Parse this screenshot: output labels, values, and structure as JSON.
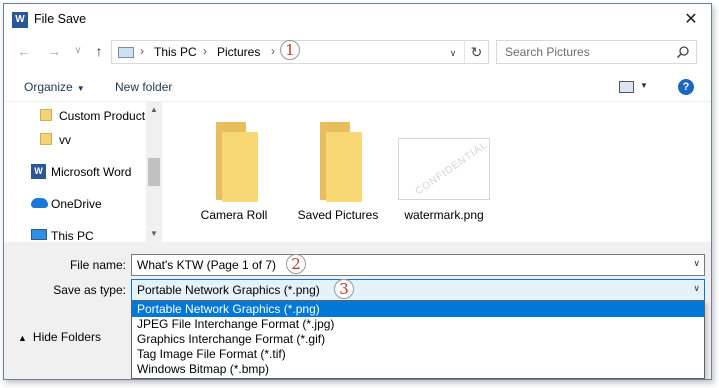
{
  "window": {
    "title": "File Save",
    "app_icon_glyph": "W",
    "close_glyph": "✕"
  },
  "nav": {
    "back_glyph": "←",
    "forward_glyph": "→",
    "history_glyph": "∨",
    "up_glyph": "↑",
    "breadcrumb": [
      "This PC",
      "Pictures"
    ],
    "separator": "›",
    "dropdown_glyph": "∨",
    "refresh_glyph": "↻",
    "search_placeholder": "Search Pictures"
  },
  "toolbar": {
    "organize_label": "Organize",
    "new_folder_label": "New folder",
    "caret": "▼",
    "help_glyph": "?"
  },
  "sidebar": {
    "items": [
      {
        "label": "Custom Product",
        "icon": "folder-icon"
      },
      {
        "label": "vv",
        "icon": "folder-icon"
      },
      {
        "label": "Microsoft Word",
        "icon": "word-icon"
      },
      {
        "label": "OneDrive",
        "icon": "onedrive-icon"
      },
      {
        "label": "This PC",
        "icon": "pc-icon"
      }
    ],
    "scroll_up_glyph": "▲",
    "scroll_down_glyph": "▼"
  },
  "files": [
    {
      "name": "Camera Roll",
      "icon": "folder-icon"
    },
    {
      "name": "Saved Pictures",
      "icon": "folder-icon"
    },
    {
      "name": "watermark.png",
      "icon": "image-thumbnail",
      "thumb_text": "CONFIDENTIAL"
    }
  ],
  "form": {
    "file_name_label": "File name:",
    "file_name_value": "What's KTW (Page 1 of 7)",
    "save_type_label": "Save as type:",
    "save_type_value": "Portable Network Graphics (*.png)",
    "type_options": [
      "Portable Network Graphics (*.png)",
      "JPEG File Interchange Format (*.jpg)",
      "Graphics Interchange Format (*.gif)",
      "Tag Image File Format (*.tif)",
      "Windows Bitmap (*.bmp)"
    ],
    "selected_option": 0,
    "caret": "∨",
    "hide_folders_label": "Hide Folders",
    "hide_caret": "▲"
  },
  "annotations": [
    "1",
    "2",
    "3"
  ],
  "colors": {
    "accent": "#0078d7",
    "badge_number": "#c0392b",
    "folder": "#f8d775"
  }
}
